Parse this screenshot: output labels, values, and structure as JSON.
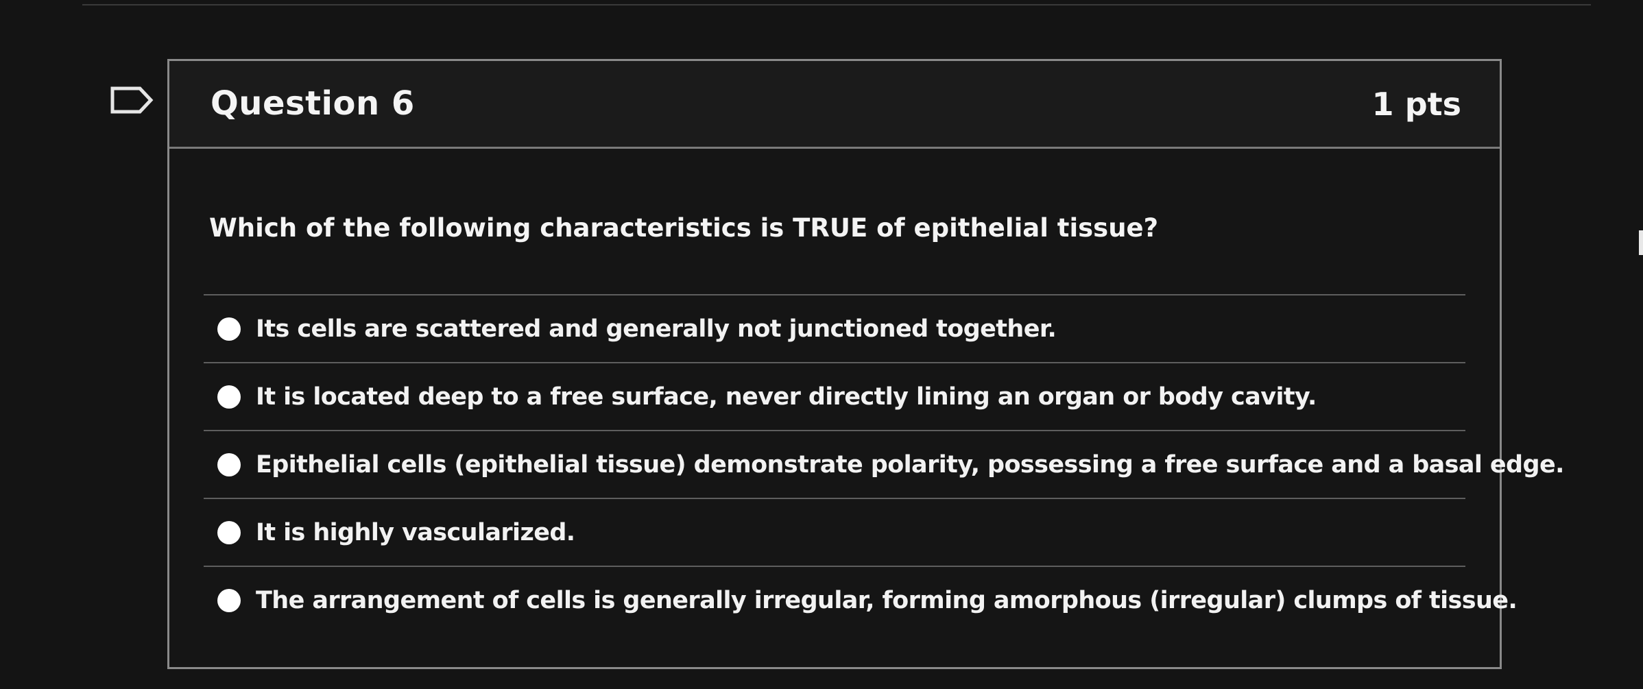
{
  "question": {
    "title": "Question 6",
    "points": "1 pts",
    "text": "Which of the following characteristics is TRUE of epithelial tissue?",
    "answers": [
      {
        "label": "Its cells are scattered and generally not junctioned together."
      },
      {
        "label": "It is located deep to a free surface, never directly lining an organ or body cavity."
      },
      {
        "label": "Epithelial cells (epithelial tissue) demonstrate polarity, possessing a free surface and a basal edge."
      },
      {
        "label": "It is highly vascularized."
      },
      {
        "label": "The arrangement of cells is generally irregular, forming amorphous (irregular) clumps of tissue."
      }
    ]
  },
  "icons": {
    "flag": "flag-question-icon"
  },
  "colors": {
    "background": "#141414",
    "card_border": "#8a8a8a",
    "text": "#f4f4f4",
    "radio": "#ffffff"
  }
}
